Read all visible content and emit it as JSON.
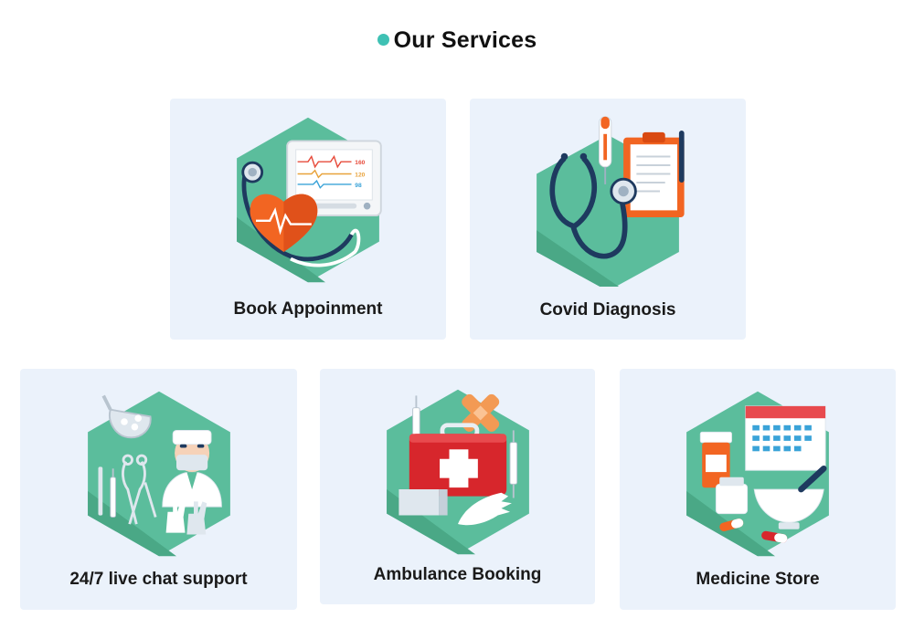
{
  "header": {
    "title": "Our Services",
    "accent_color": "#3fc1b4"
  },
  "services": [
    {
      "label": "Book Appoinment",
      "icon": "heart-monitor-icon"
    },
    {
      "label": "Covid Diagnosis",
      "icon": "stethoscope-clipboard-icon"
    },
    {
      "label": "24/7 live chat support",
      "icon": "doctor-surgery-tools-icon"
    },
    {
      "label": "Ambulance Booking",
      "icon": "first-aid-kit-icon"
    },
    {
      "label": "Medicine Store",
      "icon": "medicine-calendar-icon"
    }
  ],
  "icon_labels": {
    "monitor_readings": [
      "160",
      "120",
      "98"
    ]
  },
  "colors": {
    "card_background": "#ebf2fb",
    "hexagon": "#5bbd9c",
    "hexagon_shadow": "#4aa886",
    "orange": "#f26522",
    "red": "#d7262c",
    "navy": "#1e3a5f"
  }
}
